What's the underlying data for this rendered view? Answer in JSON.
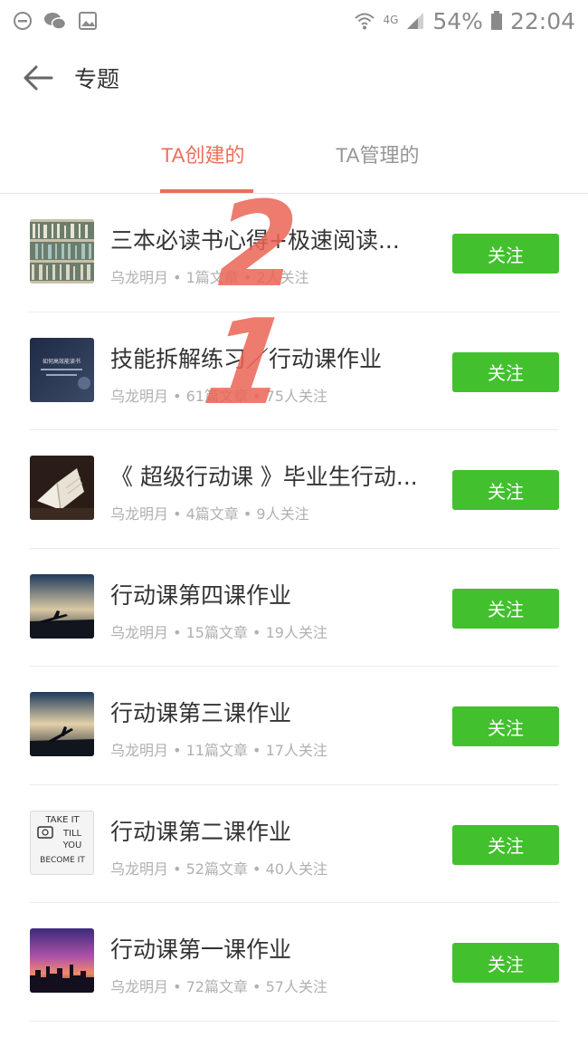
{
  "status_bar": {
    "network": "4G",
    "battery": "54%",
    "time": "22:04"
  },
  "header": {
    "title": "专题"
  },
  "tabs": [
    {
      "label": "TA创建的",
      "active": true
    },
    {
      "label": "TA管理的",
      "active": false
    }
  ],
  "items": [
    {
      "title": "三本必读书心得+极速阅读...",
      "meta": "乌龙明月 • 1篇文章 • 2人关注",
      "button": "关注"
    },
    {
      "title": "技能拆解练习／行动课作业",
      "meta": "乌龙明月 • 61篇文章 • 75人关注",
      "button": "关注",
      "thumb_text": "如何高效能读书"
    },
    {
      "title": "《 超级行动课 》毕业生行动...",
      "meta": "乌龙明月 • 4篇文章 • 9人关注",
      "button": "关注"
    },
    {
      "title": "行动课第四课作业",
      "meta": "乌龙明月 • 15篇文章 • 19人关注",
      "button": "关注"
    },
    {
      "title": "行动课第三课作业",
      "meta": "乌龙明月 • 11篇文章 • 17人关注",
      "button": "关注"
    },
    {
      "title": "行动课第二课作业",
      "meta": "乌龙明月 • 52篇文章 • 40人关注",
      "button": "关注",
      "thumb_text": [
        "TAKE IT",
        "TILL",
        "YOU",
        "BECOME IT"
      ]
    },
    {
      "title": "行动课第一课作业",
      "meta": "乌龙明月 • 72篇文章 • 57人关注",
      "button": "关注"
    }
  ],
  "annotations": [
    "2",
    "1"
  ]
}
